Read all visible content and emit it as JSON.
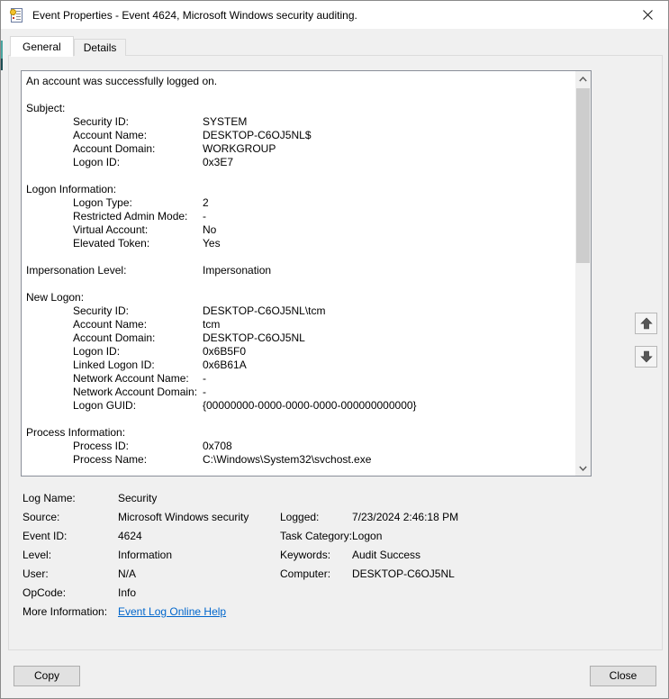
{
  "window": {
    "title": "Event Properties - Event 4624, Microsoft Windows security auditing."
  },
  "tabs": [
    {
      "label": "General",
      "active": true
    },
    {
      "label": "Details",
      "active": false
    }
  ],
  "event_text": {
    "lines": [
      {
        "label": "An account was successfully logged on.",
        "value": "",
        "indent": 0
      },
      {
        "blank": true
      },
      {
        "label": "Subject:",
        "value": "",
        "indent": 0
      },
      {
        "label": "Security ID:",
        "value": "SYSTEM",
        "indent": 1
      },
      {
        "label": "Account Name:",
        "value": "DESKTOP-C6OJ5NL$",
        "indent": 1
      },
      {
        "label": "Account Domain:",
        "value": "WORKGROUP",
        "indent": 1
      },
      {
        "label": "Logon ID:",
        "value": "0x3E7",
        "indent": 1
      },
      {
        "blank": true
      },
      {
        "label": "Logon Information:",
        "value": "",
        "indent": 0
      },
      {
        "label": "Logon Type:",
        "value": "2",
        "indent": 1
      },
      {
        "label": "Restricted Admin Mode:",
        "value": "-",
        "indent": 1
      },
      {
        "label": "Virtual Account:",
        "value": "No",
        "indent": 1
      },
      {
        "label": "Elevated Token:",
        "value": "Yes",
        "indent": 1
      },
      {
        "blank": true
      },
      {
        "label": "Impersonation Level:",
        "value": "Impersonation",
        "indent": 0
      },
      {
        "blank": true
      },
      {
        "label": "New Logon:",
        "value": "",
        "indent": 0
      },
      {
        "label": "Security ID:",
        "value": "DESKTOP-C6OJ5NL\\tcm",
        "indent": 1
      },
      {
        "label": "Account Name:",
        "value": "tcm",
        "indent": 1
      },
      {
        "label": "Account Domain:",
        "value": "DESKTOP-C6OJ5NL",
        "indent": 1
      },
      {
        "label": "Logon ID:",
        "value": "0x6B5F0",
        "indent": 1
      },
      {
        "label": "Linked Logon ID:",
        "value": "0x6B61A",
        "indent": 1
      },
      {
        "label": "Network Account Name:",
        "value": "-",
        "indent": 1
      },
      {
        "label": "Network Account Domain:",
        "value": "-",
        "indent": 1
      },
      {
        "label": "Logon GUID:",
        "value": "{00000000-0000-0000-0000-000000000000}",
        "indent": 1
      },
      {
        "blank": true
      },
      {
        "label": "Process Information:",
        "value": "",
        "indent": 0
      },
      {
        "label": "Process ID:",
        "value": "0x708",
        "indent": 1
      },
      {
        "label": "Process Name:",
        "value": "C:\\Windows\\System32\\svchost.exe",
        "indent": 1
      }
    ]
  },
  "footer": {
    "rows": [
      {
        "label": "Log Name:",
        "value": "Security",
        "label2": "",
        "value2": ""
      },
      {
        "label": "Source:",
        "value": "Microsoft Windows security",
        "label2": "Logged:",
        "value2": "7/23/2024 2:46:18 PM"
      },
      {
        "label": "Event ID:",
        "value": "4624",
        "label2": "Task Category:",
        "value2": "Logon"
      },
      {
        "label": "Level:",
        "value": "Information",
        "label2": "Keywords:",
        "value2": "Audit Success"
      },
      {
        "label": "User:",
        "value": "N/A",
        "label2": "Computer:",
        "value2": "DESKTOP-C6OJ5NL"
      },
      {
        "label": "OpCode:",
        "value": "Info",
        "label2": "",
        "value2": ""
      },
      {
        "label": "More Information:",
        "value": "Event Log Online Help",
        "link": true,
        "label2": "",
        "value2": ""
      }
    ]
  },
  "buttons": {
    "copy_label": "Copy",
    "close_label": "Close"
  },
  "colors": {
    "dialog_bg": "#f0f0f0",
    "titlebar_bg": "#ffffff",
    "link_blue": "#0066cc",
    "button_bg": "#e1e1e1",
    "button_border": "#adadad",
    "scroll_thumb": "#cdcdcd",
    "textarea_border": "#8a8f99"
  }
}
